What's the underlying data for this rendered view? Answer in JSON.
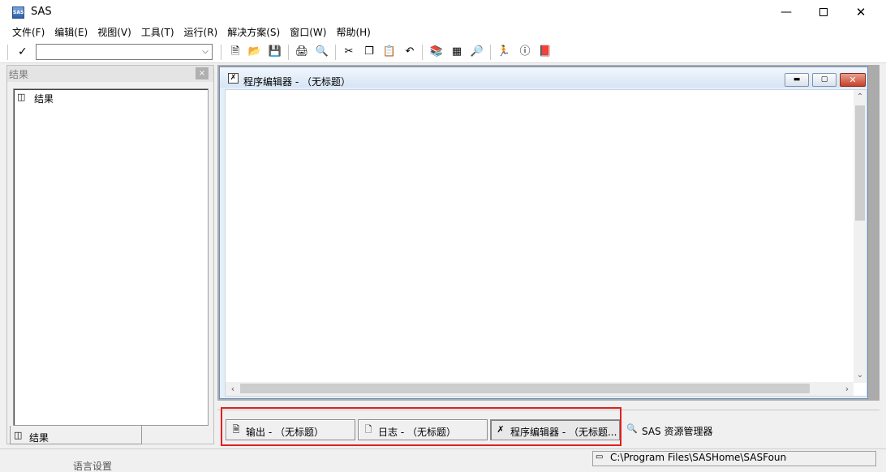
{
  "window": {
    "title": "SAS",
    "app_icon_text": "SAS",
    "minimize_glyph": "—",
    "close_glyph": "✕"
  },
  "menubar": {
    "items": [
      "文件(F)",
      "编辑(E)",
      "视图(V)",
      "工具(T)",
      "运行(R)",
      "解决方案(S)",
      "窗口(W)",
      "帮助(H)"
    ]
  },
  "toolbar": {
    "command_check_glyph": "✓",
    "command_value": "",
    "buttons": [
      "new-icon",
      "open-icon",
      "save-icon",
      "print-icon",
      "print-preview-icon",
      "cut-icon",
      "copy-icon",
      "paste-icon",
      "undo-icon",
      "new-library-icon",
      "explorer-icon",
      "find-icon",
      "run-icon",
      "break-icon",
      "help-book-icon"
    ]
  },
  "results_panel": {
    "header": "结果",
    "close_glyph": "×",
    "tree_item": "结果",
    "tab_label": "结果"
  },
  "editor_window": {
    "title": "程序编辑器 - （无标题）",
    "icon_glyph": "✗",
    "content": ""
  },
  "window_tabs": [
    {
      "label": "输出 - （无标题）",
      "icon": "output-icon"
    },
    {
      "label": "日志 - （无标题）",
      "icon": "log-icon"
    },
    {
      "label": "程序编辑器 - （无标题...",
      "icon": "editor-icon"
    },
    {
      "label": "SAS 资源管理器",
      "icon": "explorer-icon"
    }
  ],
  "statusbar": {
    "path": "C:\\Program Files\\SASHome\\SASFound"
  },
  "behind_window_text": "语言设置",
  "colors": {
    "highlight": "#e02020",
    "editor_title_bg": "#d6e4f5"
  }
}
